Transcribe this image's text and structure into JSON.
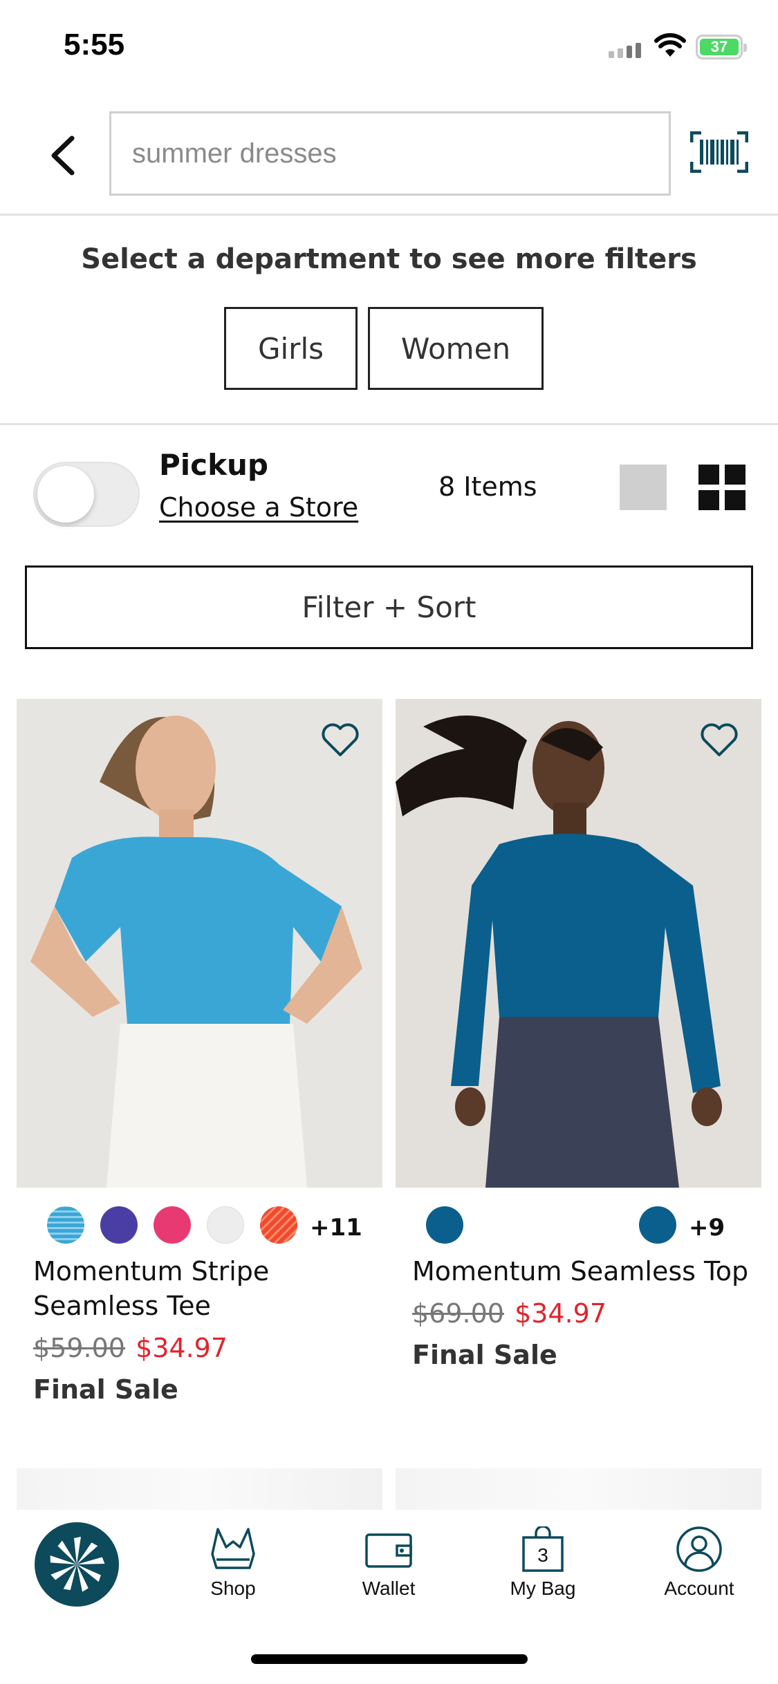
{
  "status_bar": {
    "time": "5:55",
    "battery": "37"
  },
  "search": {
    "placeholder": "summer dresses"
  },
  "department": {
    "title": "Select a department to see more filters",
    "buttons": [
      "Girls",
      "Women"
    ]
  },
  "pickup": {
    "label": "Pickup",
    "store_link": "Choose a Store",
    "enabled": false
  },
  "items_count": "8 Items",
  "filter_sort": "Filter + Sort",
  "products": [
    {
      "name_line1": "Momentum Stripe",
      "name_line2": "Seamless Tee",
      "old_price": "$59.00",
      "new_price": "$34.97",
      "sale_label": "Final Sale",
      "swatches": [
        "#3aa6d6",
        "#4a3ea5",
        "#e83a72",
        "#ededed",
        "#f04a2e"
      ],
      "more_colors": "+11"
    },
    {
      "name": "Momentum Seamless Top",
      "old_price": "$69.00",
      "new_price": "$34.97",
      "sale_label": "Final Sale",
      "swatches": [
        "#0b5f8c",
        "#0b5f8c"
      ],
      "more_colors": "+9"
    }
  ],
  "tabs": [
    {
      "label": "Shop",
      "icon": "sports-bra-icon"
    },
    {
      "label": "Wallet",
      "icon": "wallet-icon"
    },
    {
      "label": "My Bag",
      "icon": "bag-icon",
      "badge": "3"
    },
    {
      "label": "Account",
      "icon": "account-icon"
    }
  ],
  "colors": {
    "accent_dark": "#0d4a5c",
    "sale_red": "#e0242c",
    "shirt_blue_1": "#3aa6d6",
    "shirt_blue_2": "#0b5f8c"
  }
}
